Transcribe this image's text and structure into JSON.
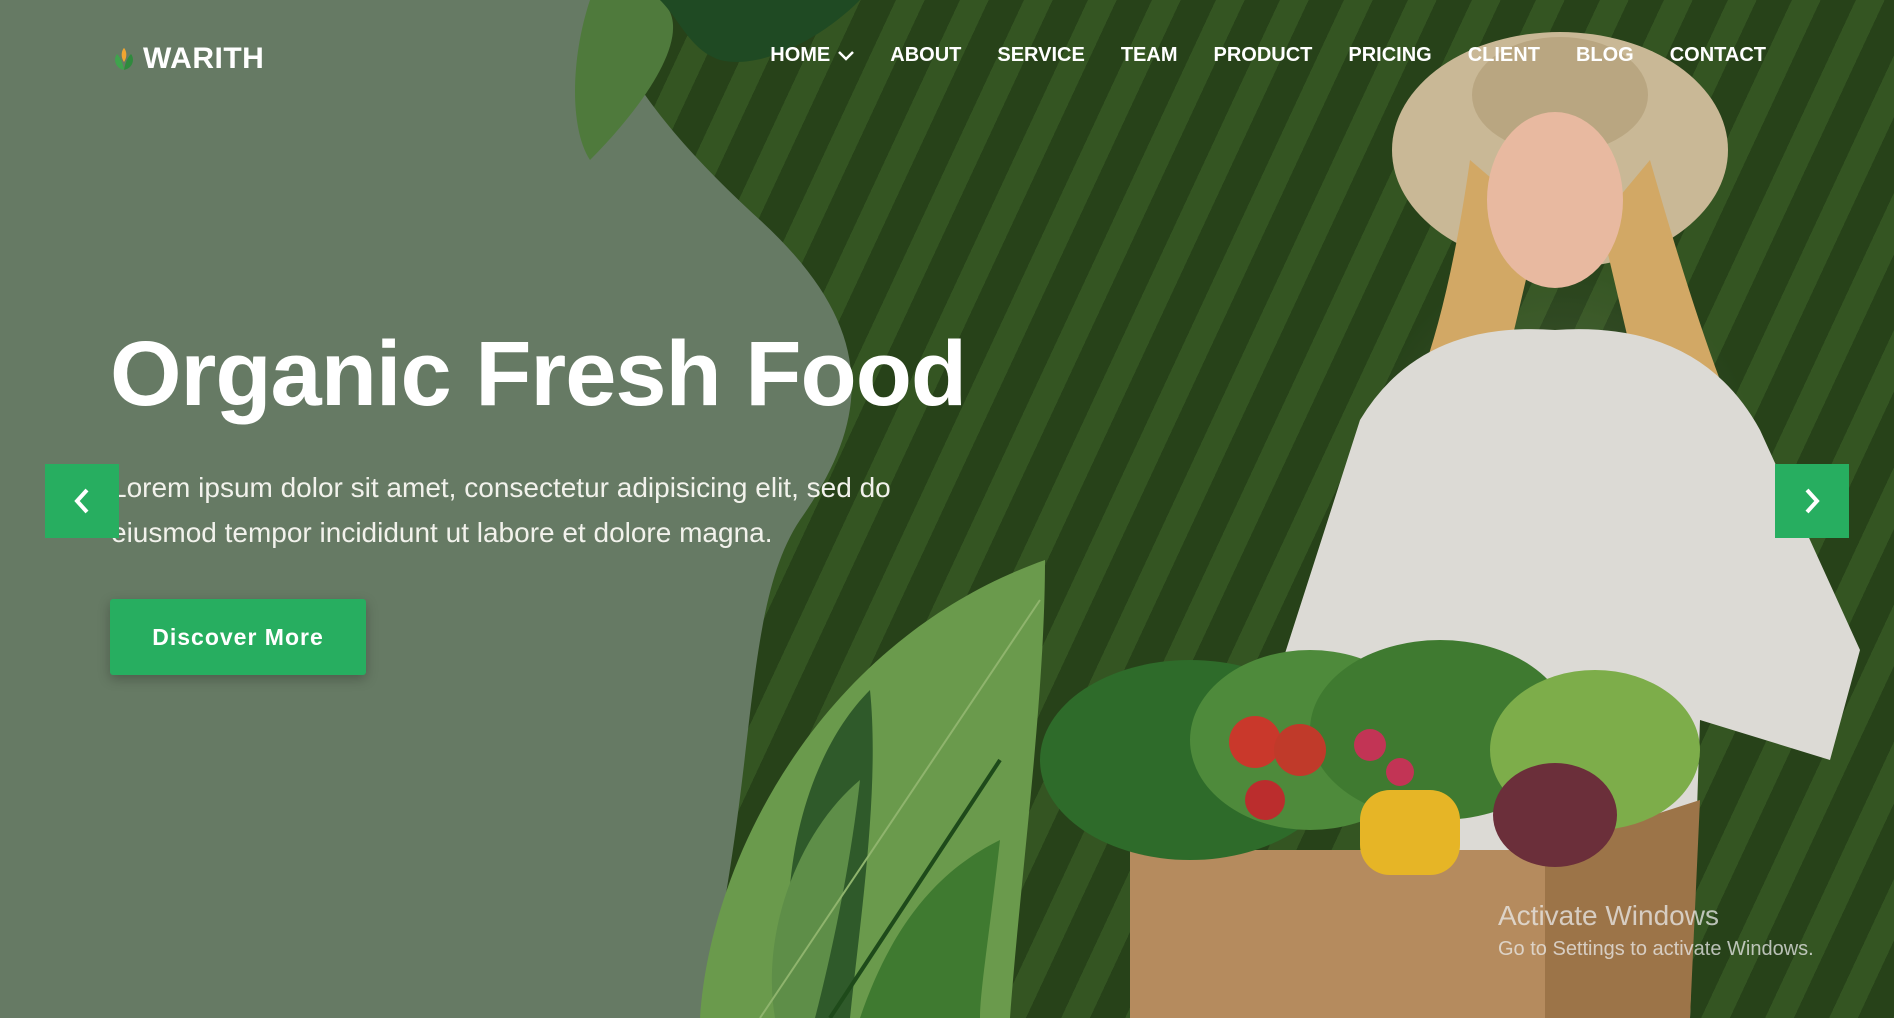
{
  "brand": {
    "name": "WARITH"
  },
  "nav": {
    "items": [
      {
        "label": "HOME",
        "has_dropdown": true
      },
      {
        "label": "ABOUT"
      },
      {
        "label": "SERVICE"
      },
      {
        "label": "TEAM"
      },
      {
        "label": "PRODUCT"
      },
      {
        "label": "PRICING"
      },
      {
        "label": "CLIENT"
      },
      {
        "label": "BLOG"
      },
      {
        "label": "CONTACT"
      }
    ]
  },
  "hero": {
    "title": "Organic Fresh Food",
    "text": "Lorem ipsum dolor sit amet, consectetur adipisicing elit, sed do eiusmod tempor incididunt ut labore et dolore magna.",
    "cta_label": "Discover More"
  },
  "slider": {
    "prev_icon": "chevron-left-icon",
    "next_icon": "chevron-right-icon"
  },
  "watermark": {
    "title": "Activate Windows",
    "subtitle": "Go to Settings to activate Windows."
  },
  "colors": {
    "accent": "#27ae60",
    "panel": "#667a64",
    "text": "#ffffff"
  }
}
